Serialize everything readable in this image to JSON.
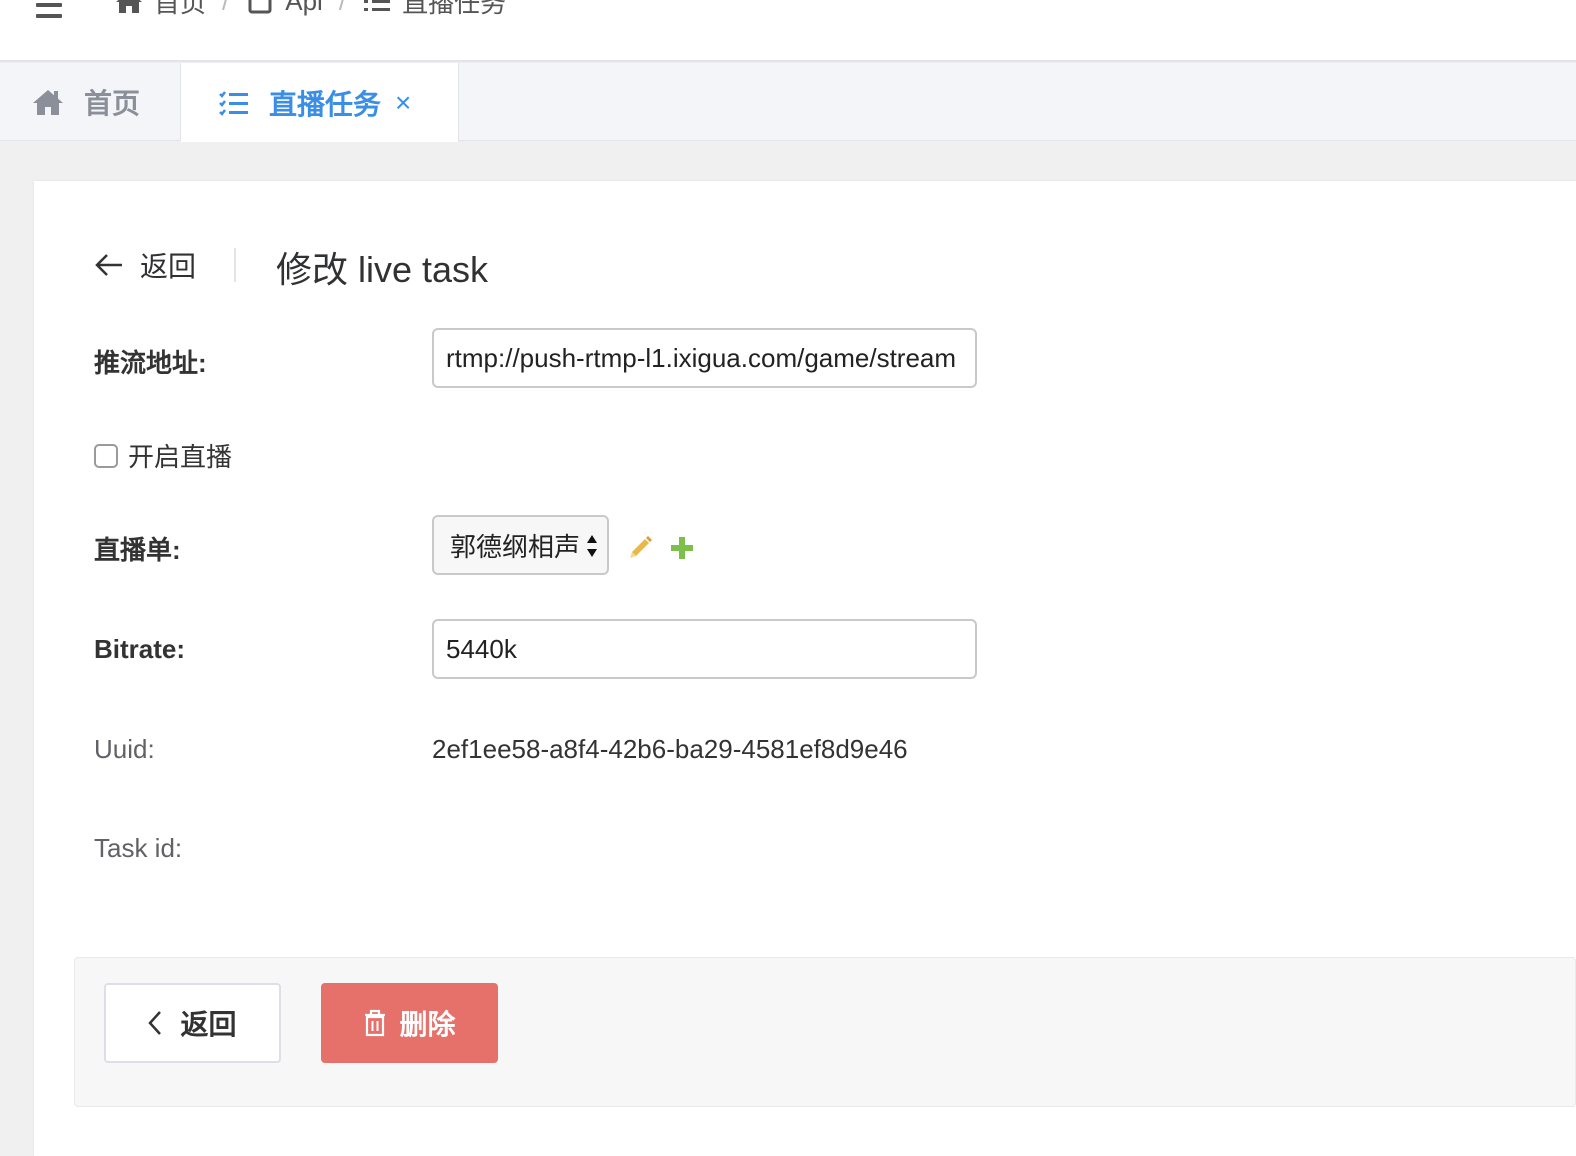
{
  "header": {
    "breadcrumb": [
      {
        "label": "首页",
        "icon": "home-icon"
      },
      {
        "label": "Api",
        "icon": "file-icon"
      },
      {
        "label": "直播任务",
        "icon": "list-icon"
      }
    ],
    "separator": "/"
  },
  "tabs": [
    {
      "label": "首页",
      "icon": "home-icon",
      "active": false
    },
    {
      "label": "直播任务",
      "icon": "list-icon",
      "active": true,
      "closable": true,
      "close_glyph": "×"
    }
  ],
  "page": {
    "back_label": "返回",
    "title": "修改 live task"
  },
  "form": {
    "push_url": {
      "label": "推流地址:",
      "value": "rtmp://push-rtmp-l1.ixigua.com/game/stream"
    },
    "enable_live": {
      "label": "开启直播",
      "checked": false
    },
    "playlist": {
      "label": "直播单:",
      "selected": "郭德纲相声"
    },
    "bitrate": {
      "label": "Bitrate:",
      "value": "5440k"
    },
    "uuid": {
      "label": "Uuid:",
      "value": "2ef1ee58-a8f4-42b6-ba29-4581ef8d9e46"
    },
    "task_id": {
      "label": "Task id:",
      "value": ""
    }
  },
  "footer": {
    "back_label": "返回",
    "delete_label": "删除"
  },
  "colors": {
    "accent": "#3a8ee6",
    "danger": "#e6716b",
    "edit": "#e8b84a",
    "add": "#7cc04b"
  }
}
